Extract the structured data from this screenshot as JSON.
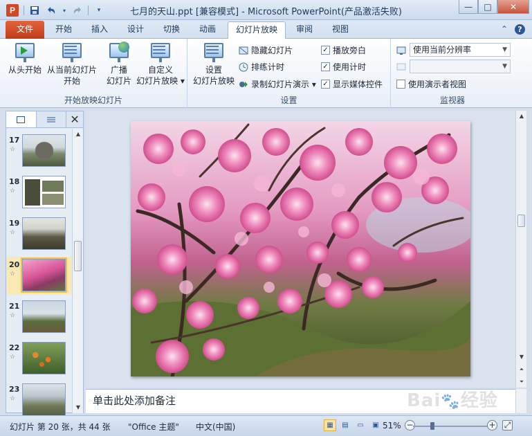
{
  "window": {
    "title": "七月的天山.ppt [兼容模式] - Microsoft PowerPoint(产品激活失败)",
    "app_icon": "P",
    "minimize": "—",
    "maximize": "□",
    "close": "✕"
  },
  "quick_access": {
    "save_icon": "save-icon",
    "undo_icon": "undo-icon",
    "redo_icon": "redo-icon",
    "customize_icon": "dropdown-icon"
  },
  "tabs": [
    {
      "label": "文件",
      "kind": "file"
    },
    {
      "label": "开始"
    },
    {
      "label": "插入"
    },
    {
      "label": "设计"
    },
    {
      "label": "切换"
    },
    {
      "label": "动画"
    },
    {
      "label": "幻灯片放映",
      "active": true
    },
    {
      "label": "审阅"
    },
    {
      "label": "视图"
    }
  ],
  "ribbon": {
    "group_start": {
      "label": "开始放映幻灯片",
      "from_beginning": "从头开始",
      "from_current_1": "从当前幻灯片",
      "from_current_2": "开始",
      "broadcast_1": "广播",
      "broadcast_2": "幻灯片",
      "custom_1": "自定义",
      "custom_2": "幻灯片放映 ▾"
    },
    "group_setup": {
      "label": "设置",
      "setup_1": "设置",
      "setup_2": "幻灯片放映",
      "hide_slide": "隐藏幻灯片",
      "rehearse": "排练计时",
      "record": "录制幻灯片演示 ▾",
      "play_narrations": "播放旁白",
      "use_timings": "使用计时",
      "show_media_controls": "显示媒体控件",
      "play_narrations_checked": true,
      "use_timings_checked": true,
      "show_media_controls_checked": true
    },
    "group_monitors": {
      "label": "监视器",
      "resolution": "使用当前分辨率",
      "show_on": "",
      "presenter_view": "使用演示者视图",
      "presenter_view_checked": false
    }
  },
  "slides_pane": {
    "thumbnails": [
      {
        "num": "17",
        "star": "☆"
      },
      {
        "num": "18",
        "star": "☆"
      },
      {
        "num": "19",
        "star": "☆"
      },
      {
        "num": "20",
        "star": "☆",
        "selected": true
      },
      {
        "num": "21",
        "star": "☆"
      },
      {
        "num": "22",
        "star": "☆"
      },
      {
        "num": "23",
        "star": "☆"
      }
    ]
  },
  "notes_placeholder": "单击此处添加备注",
  "status": {
    "slide_info": "幻灯片 第 20 张，共 44 张",
    "theme": "\"Office 主题\"",
    "language": "中文(中国)",
    "zoom": "51%",
    "zoom_level_fraction": 0.51
  },
  "watermark": "Bai 经验"
}
